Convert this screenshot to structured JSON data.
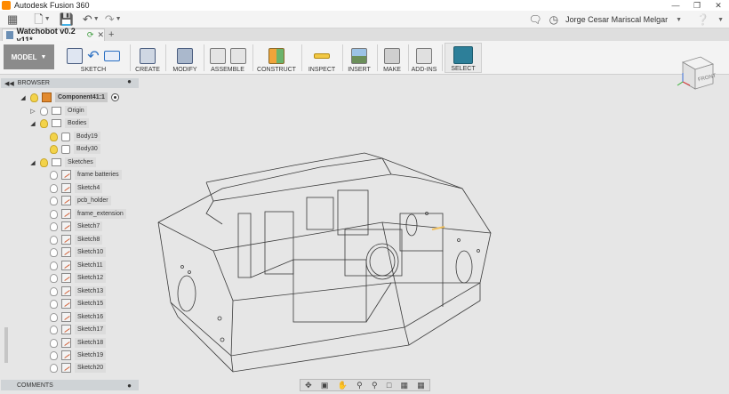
{
  "app": {
    "title": "Autodesk Fusion 360",
    "user": "Jorge Cesar Mariscal Melgar"
  },
  "document": {
    "tab_name": "Watchobot v0.2 v11*"
  },
  "toolbar": {
    "workspace": "MODEL",
    "groups": [
      "SKETCH",
      "CREATE",
      "MODIFY",
      "ASSEMBLE",
      "CONSTRUCT",
      "INSPECT",
      "INSERT",
      "MAKE",
      "ADD-INS",
      "SELECT"
    ]
  },
  "browser": {
    "title": "BROWSER",
    "items": [
      {
        "label": "Component41:1",
        "level": 0
      },
      {
        "label": "Origin",
        "level": 1
      },
      {
        "label": "Bodies",
        "level": 1
      },
      {
        "label": "Body19",
        "level": 2
      },
      {
        "label": "Body30",
        "level": 2
      },
      {
        "label": "Sketches",
        "level": 1
      },
      {
        "label": "frame batteries",
        "level": 2
      },
      {
        "label": "Sketch4",
        "level": 2
      },
      {
        "label": "pcb_holder",
        "level": 2
      },
      {
        "label": "frame_extension",
        "level": 2
      },
      {
        "label": "Sketch7",
        "level": 2
      },
      {
        "label": "Sketch8",
        "level": 2
      },
      {
        "label": "Sketch10",
        "level": 2
      },
      {
        "label": "Sketch11",
        "level": 2
      },
      {
        "label": "Sketch12",
        "level": 2
      },
      {
        "label": "Sketch13",
        "level": 2
      },
      {
        "label": "Sketch15",
        "level": 2
      },
      {
        "label": "Sketch16",
        "level": 2
      },
      {
        "label": "Sketch17",
        "level": 2
      },
      {
        "label": "Sketch18",
        "level": 2
      },
      {
        "label": "Sketch19",
        "level": 2
      },
      {
        "label": "Sketch20",
        "level": 2
      }
    ]
  },
  "comments": {
    "title": "COMMENTS"
  },
  "viewcube": {
    "face": "FRONT"
  },
  "colors": {
    "accent_select": "#2d7f99",
    "component_icon": "#e28a2e",
    "bulb_on": "#f3d34a"
  }
}
